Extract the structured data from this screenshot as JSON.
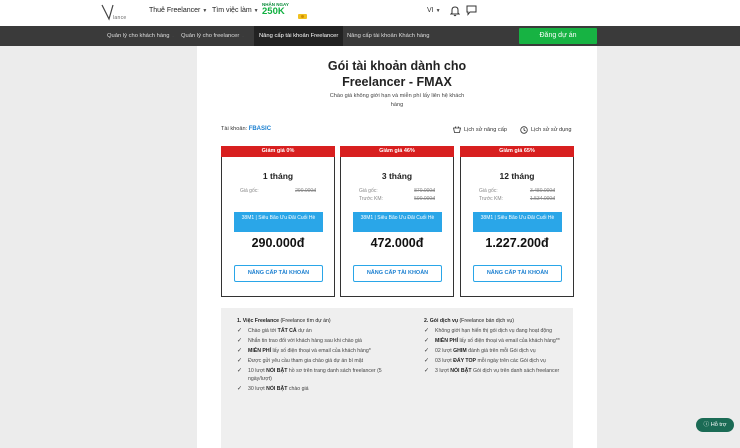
{
  "header": {
    "logo_text": "lance",
    "nav": [
      {
        "label": "Thuê Freelancer"
      },
      {
        "label": "Tìm việc làm"
      }
    ],
    "promo": {
      "top": "NHẬN NGAY",
      "amount": "250K"
    },
    "language": "VI"
  },
  "subnav": {
    "items": [
      {
        "label": "Quản lý cho khách hàng"
      },
      {
        "label": "Quản lý cho freelancer"
      },
      {
        "label": "Nâng cấp tài khoản Freelancer"
      },
      {
        "label": "Nâng cấp tài khoản Khách hàng"
      }
    ],
    "post_button": "Đăng dự án"
  },
  "page": {
    "title_line1": "Gói tài khoản dành cho",
    "title_line2": "Freelancer - FMAX",
    "subtitle": "Chào giá không giới hạn và miễn phí lấy liên hệ khách hàng",
    "account_label": "Tài khoản:",
    "account_value": "FBASIC",
    "upgrade_history": "Lịch sử nâng cấp",
    "usage_history": "Lịch sử sử dụng"
  },
  "plans": [
    {
      "discount": "Giảm giá 0%",
      "duration": "1 tháng",
      "original_label": "Giá gốc:",
      "original": "290.000đ",
      "km_label": "",
      "km": "",
      "coupon": "38M1 | Siêu Bão Ưu Đãi Cuối Hè",
      "final": "290.000đ",
      "button": "NÂNG CẤP TÀI KHOẢN"
    },
    {
      "discount": "Giảm giá 46%",
      "duration": "3 tháng",
      "original_label": "Giá gốc:",
      "original": "870.000đ",
      "km_label": "Trước KM:",
      "km": "590.000đ",
      "coupon": "38M1 | Siêu Bão Ưu Đãi Cuối Hè",
      "final": "472.000đ",
      "button": "NÂNG CẤP TÀI KHOẢN"
    },
    {
      "discount": "Giảm giá 65%",
      "duration": "12 tháng",
      "original_label": "Giá gốc:",
      "original": "3.480.000đ",
      "km_label": "Trước KM:",
      "km": "1.534.000đ",
      "coupon": "38M1 | Siêu Bão Ưu Đãi Cuối Hè",
      "final": "1.227.200đ",
      "button": "NÂNG CẤP TÀI KHOẢN"
    }
  ],
  "features": {
    "col1": {
      "heading_bold": "1. Việc Freelance",
      "heading_rest": " (Freelance tìm dự án)",
      "items": [
        {
          "pre": "Chào giá tới ",
          "bold": "TẤT CẢ",
          "post": " dự án"
        },
        {
          "pre": "Nhắn tin trao đổi với khách hàng sau khi chào giá",
          "bold": "",
          "post": ""
        },
        {
          "pre": "",
          "bold": "MIỄN PHÍ",
          "post": " lấy số điện thoại và email của khách hàng*"
        },
        {
          "pre": "Được gửi yêu cầu tham gia chào giá dự án bí mật",
          "bold": "",
          "post": ""
        },
        {
          "pre": "10 lượt ",
          "bold": "NỔI BẬT",
          "post": " hồ sơ trên trang danh sách freelancer (5 ngày/lượt)"
        },
        {
          "pre": "30 lượt ",
          "bold": "NỔI BẬT",
          "post": " chào giá"
        }
      ]
    },
    "col2": {
      "heading_bold": "2. Gói dịch vụ",
      "heading_rest": " (Freelance bán dịch vụ)",
      "items": [
        {
          "pre": "Không giới hạn hiển thị gói dịch vụ đang hoạt động",
          "bold": "",
          "post": ""
        },
        {
          "pre": "",
          "bold": "MIỄN PHÍ",
          "post": " lấy số điện thoại và email của khách hàng**"
        },
        {
          "pre": "02 lượt ",
          "bold": "GHIM",
          "post": " đánh giá trên mỗi Gói dịch vụ"
        },
        {
          "pre": "03 lượt ",
          "bold": "ĐẨY TOP",
          "post": " mỗi ngày trên các Gói dịch vụ"
        },
        {
          "pre": "3 lượt ",
          "bold": "NỔI BẬT",
          "post": " Gói dịch vụ trên danh sách freelancer"
        }
      ]
    }
  },
  "help_button": "Hỗ trợ"
}
